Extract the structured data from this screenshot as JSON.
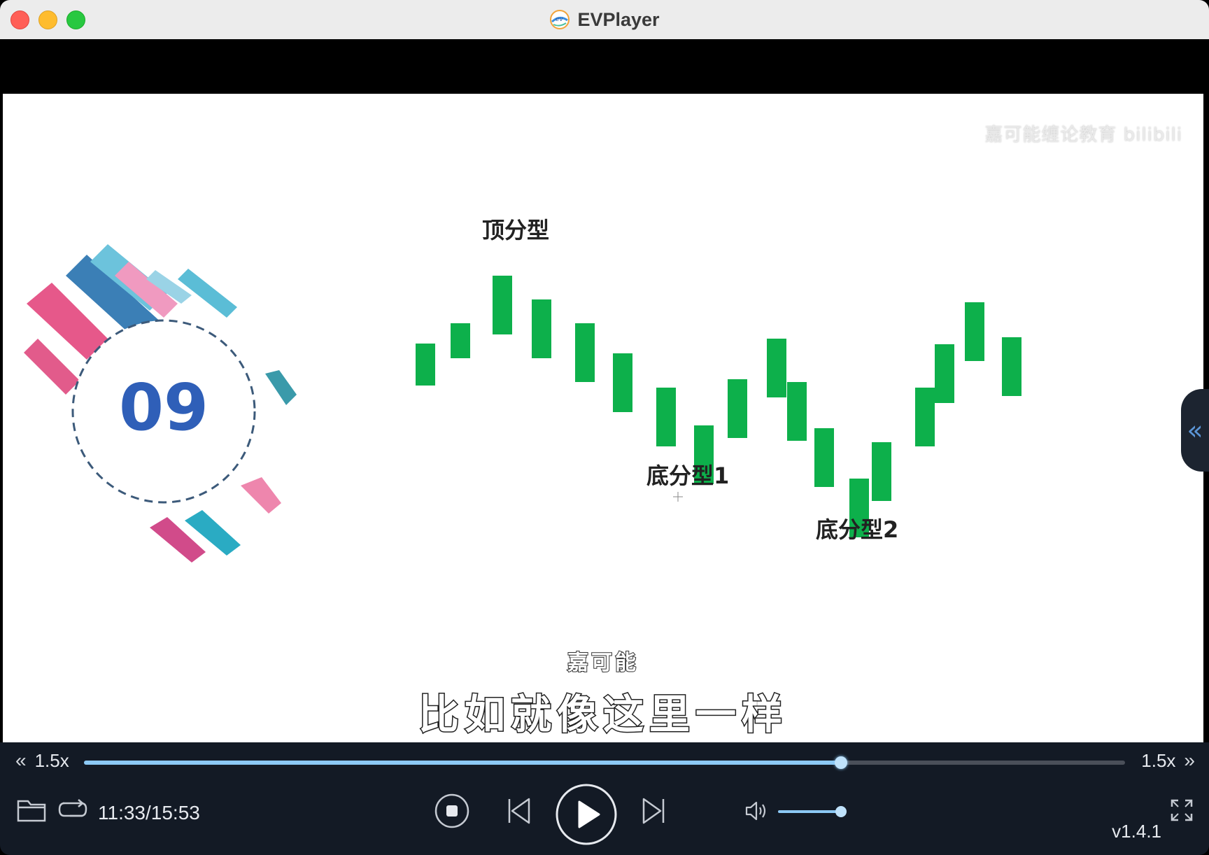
{
  "window": {
    "title": "EVPlayer",
    "app_logo": "ev-logo-icon"
  },
  "video": {
    "watermark": "嘉可能缠论教育 bilibili",
    "chapter_number": "09",
    "labels": {
      "top_fractal": "顶分型",
      "bottom_fractal_1": "底分型1",
      "bottom_fractal_2": "底分型2"
    },
    "candle_color": "#0db04b",
    "speaker": "嘉可能",
    "subtitle": "比如就像这里一样"
  },
  "controls": {
    "speed_left": "1.5x",
    "speed_right": "1.5x",
    "progress": 0.727,
    "time": "11:33/15:53",
    "volume": 0.9,
    "version": "v1.4.1",
    "accent_color": "#8cc9f5"
  }
}
